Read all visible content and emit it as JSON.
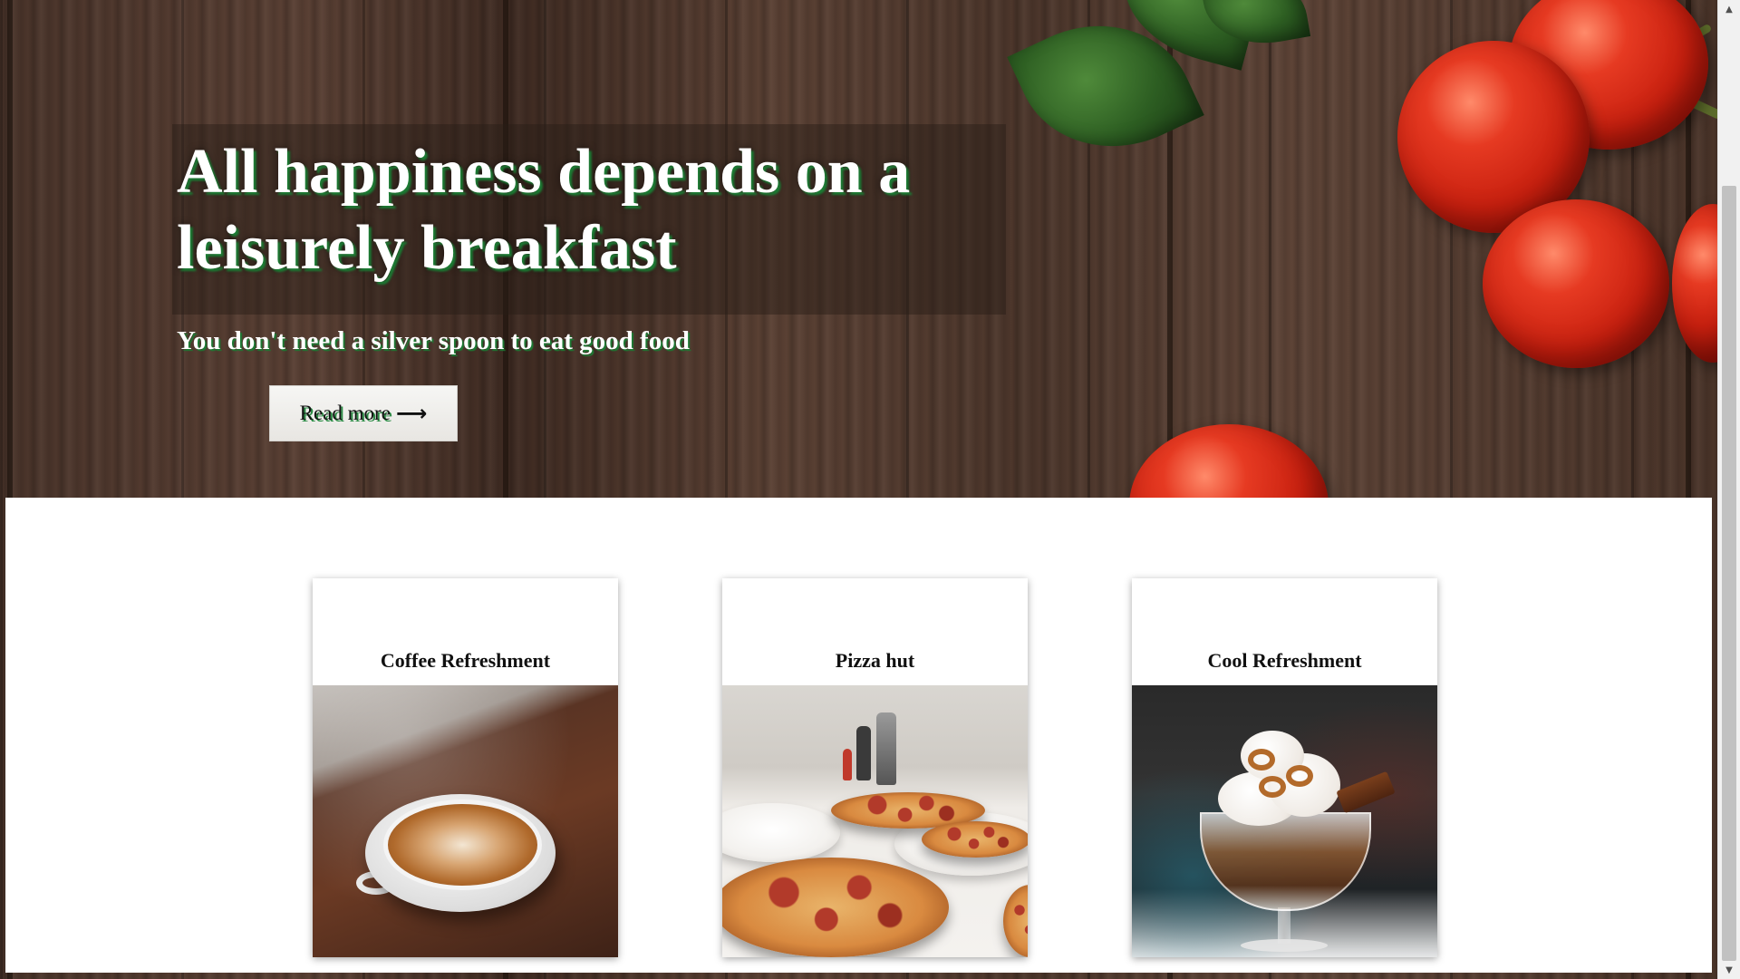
{
  "hero": {
    "title": "All happiness depends on a leisurely breakfast",
    "subtitle": "You don't need a silver spoon to eat good food",
    "button_label": "Read more",
    "button_icon": "arrow-right-icon"
  },
  "cards": [
    {
      "title": "Coffee Refreshment",
      "image": "latte-art-coffee-cup"
    },
    {
      "title": "Pizza hut",
      "image": "pizzas-on-table"
    },
    {
      "title": "Cool Refreshment",
      "image": "ice-cream-sundae"
    }
  ],
  "scrollbar": {
    "up_icon": "▲",
    "down_icon": "▼"
  },
  "colors": {
    "text_shadow_accent": "#1c7a33",
    "panel_background": "#ffffff"
  }
}
